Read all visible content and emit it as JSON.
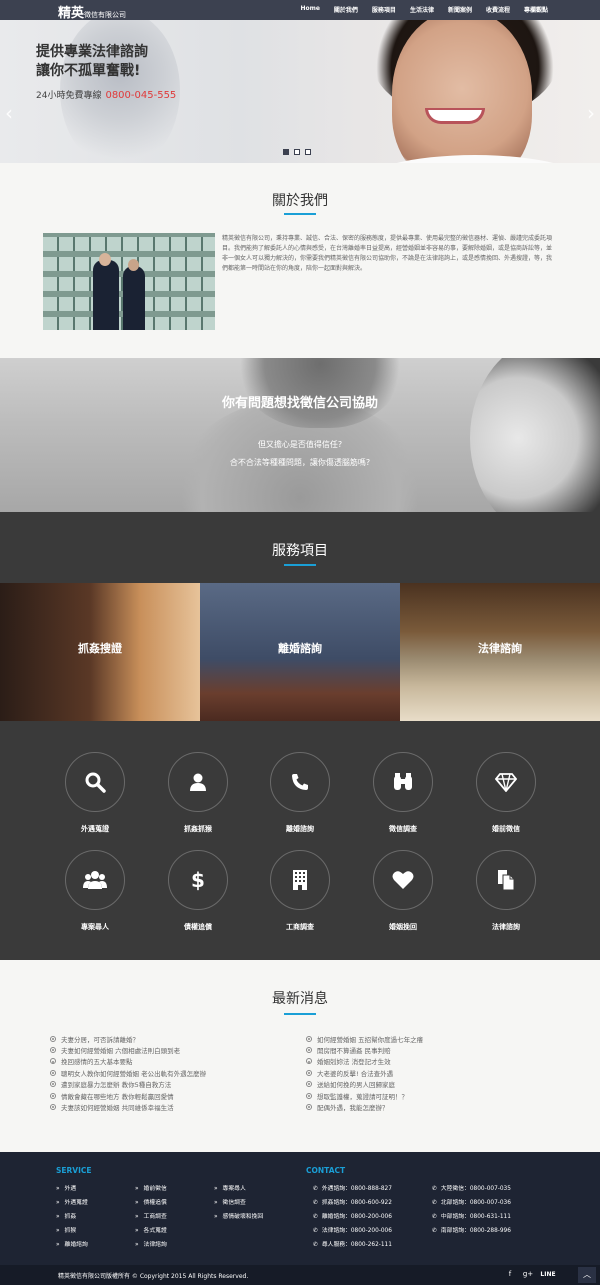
{
  "header": {
    "logo_big": "精英",
    "logo_small": "徵信有限公司",
    "nav": [
      "Home",
      "關於我們",
      "服務項目",
      "生活法律",
      "新聞案例",
      "收費流程",
      "專欄觀點"
    ]
  },
  "hero": {
    "title_line1": "提供專業法律諮詢",
    "title_line2": "讓你不孤單奮戰!",
    "sub_label": "24小時免費專線",
    "phone": "0800-045-555",
    "prev_arrow": "‹",
    "next_arrow": "›",
    "slides": 3,
    "active_slide": 1
  },
  "about": {
    "title": "關於我們",
    "text": "精英徵信有限公司，秉持專業、誠信、合法、保密的服務態度，提供最專業、使用最完整的徵信器材、運偵、嚴謹完成委託項目。我們能夠了解委託人的心情與感受，在台灣離婚率日益提高，經營婚姻並非容易的事，要解除婚姻，或是協商訴訟等，並非一個女人可以獨力解決的，你需要我們精英徵信有限公司協助你，不論是在法律諮詢上，或是感情挽回、外遇搜證，等，我們都能第一時間站在你的角度，陪你一起面對與解決。"
  },
  "banner": {
    "title": "你有問題想找徵信公司協助",
    "line1": "但又擔心是否值得信任?",
    "line2": "合不合法等種種問題，讓你傷透腦筋嗎?"
  },
  "services": {
    "title": "服務項目",
    "tiles": [
      "抓姦搜證",
      "離婚諮詢",
      "法律諮詢"
    ],
    "icons": [
      {
        "label": "外遇蒐證",
        "icon": "search-icon"
      },
      {
        "label": "抓姦抓猴",
        "icon": "user-icon"
      },
      {
        "label": "離婚諮詢",
        "icon": "phone-icon"
      },
      {
        "label": "徵信調查",
        "icon": "binoculars-icon"
      },
      {
        "label": "婚前徵信",
        "icon": "diamond-icon"
      },
      {
        "label": "專案尋人",
        "icon": "group-icon"
      },
      {
        "label": "債權追償",
        "icon": "dollar-icon"
      },
      {
        "label": "工商調查",
        "icon": "building-icon"
      },
      {
        "label": "婚姻挽回",
        "icon": "heart-icon"
      },
      {
        "label": "法律諮詢",
        "icon": "document-icon"
      }
    ]
  },
  "news": {
    "title": "最新消息",
    "left": [
      "夫妻分居，可否訴請離婚？",
      "夫妻如何經營婚姻 六個相處法則白頭到老",
      "挽回感情的五大基本要點",
      "聰明女人教你如何經營婚姻 老公出軌有外遇怎麼辦",
      "遭到家庭暴力怎麼辦 教你5種自救方法",
      "情敵會藏在哪些地方 教你輕鬆贏回愛情",
      "夫妻該如何經營婚姻 共同維係幸福生活"
    ],
    "right": [
      "如何經營婚姻 五招幫你度過七年之癢",
      "開房間不算通姦 民事判賠",
      "婚姻剋妳法 消登記才生效",
      "大老婆的反擊! 合法查外遇",
      "送給如何挽的男人回歸家庭",
      "想取監護權，蒐證請可証明！？",
      "配偶外遇，我能怎麼辦？"
    ]
  },
  "footer": {
    "service_head": "SERVICE",
    "contact_head": "CONTACT",
    "links_col1": [
      "外遇",
      "外遇蒐證",
      "抓姦",
      "抓猴",
      "離婚諮詢"
    ],
    "links_col2": [
      "婚前徵信",
      "債權追償",
      "工商調查",
      "各式蒐證",
      "法律諮詢"
    ],
    "links_col3": [
      "專案尋人",
      "徵信調查",
      "感情破壞和挽回"
    ],
    "phones_col1": [
      "外遇諮詢：0800-888-827",
      "抓姦諮詢：0800-600-922",
      "離婚諮詢：0800-200-006",
      "法律諮詢：0800-200-006",
      "尋人服務：0800-262-111"
    ],
    "phones_col2": [
      "大陸徵信：0800-007-035",
      "北部諮詢：0800-007-036",
      "中部諮詢：0800-631-111",
      "南部諮詢：0800-288-996"
    ],
    "copyright": "精英徵信有限公司版權所有 © Copyright 2015 All Rights Reserved.",
    "social": [
      "f",
      "g+",
      "LINE"
    ],
    "to_top": "︿"
  },
  "colors": {
    "header_bg": "#3c4150",
    "accent": "#1a9fd6",
    "phone_red": "#e03a3a",
    "services_bg": "#3a3a3a",
    "footer_bg": "#1e2433"
  }
}
